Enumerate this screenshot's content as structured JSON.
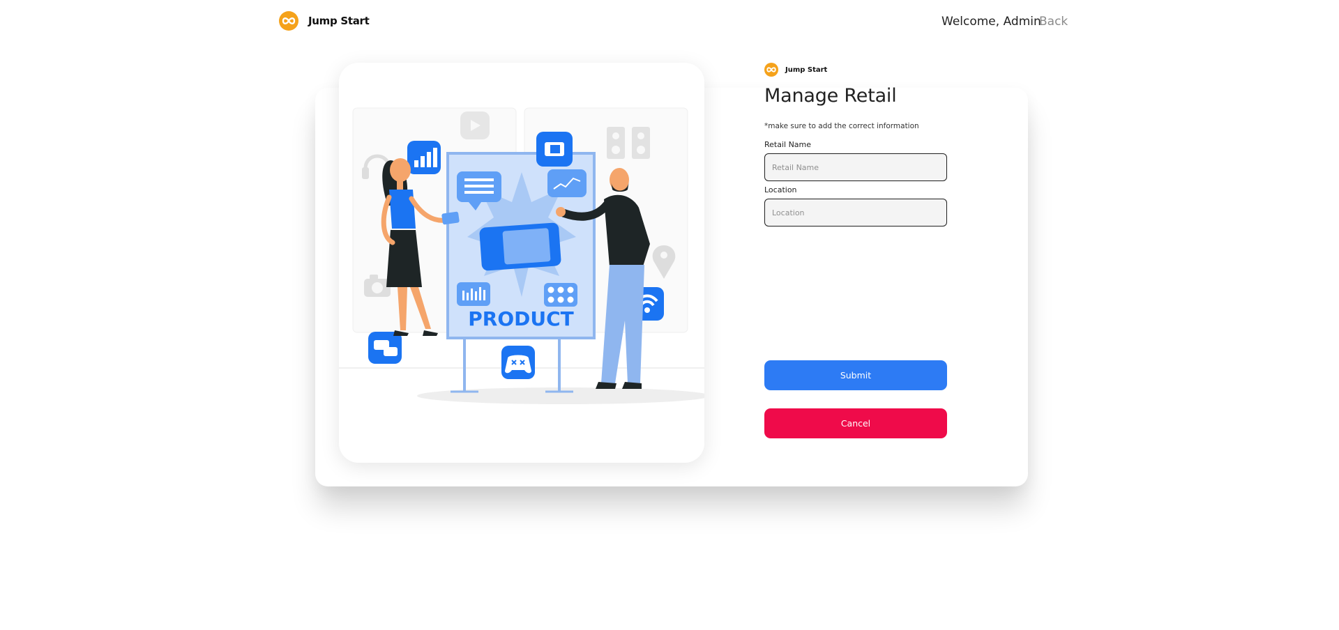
{
  "header": {
    "brand_name": "Jump Start",
    "welcome_text": "Welcome, Admin",
    "back_label": "Back"
  },
  "illustration": {
    "product_label": "PRODUCT"
  },
  "form": {
    "brand_name": "Jump Start",
    "title": "Manage Retail",
    "hint": "*make sure to add the correct information",
    "retail_name": {
      "label": "Retail Name",
      "placeholder": "Retail Name",
      "value": ""
    },
    "location": {
      "label": "Location",
      "placeholder": "Location",
      "value": ""
    },
    "submit_label": "Submit",
    "cancel_label": "Cancel"
  },
  "colors": {
    "brand": "#f5a21b",
    "primary": "#2d7bf4",
    "danger": "#ef0b4a",
    "illustration_blue": "#1b74f2"
  },
  "icons": [
    "logo-icon",
    "signal-icon",
    "document-icon",
    "speaker-icon",
    "headphones-icon",
    "youtube-icon",
    "message-icon",
    "chart-icon",
    "analytics-icon",
    "grid-icon",
    "location-pin-icon",
    "camera-icon",
    "chat-icon",
    "gamepad-icon",
    "wifi-icon"
  ]
}
